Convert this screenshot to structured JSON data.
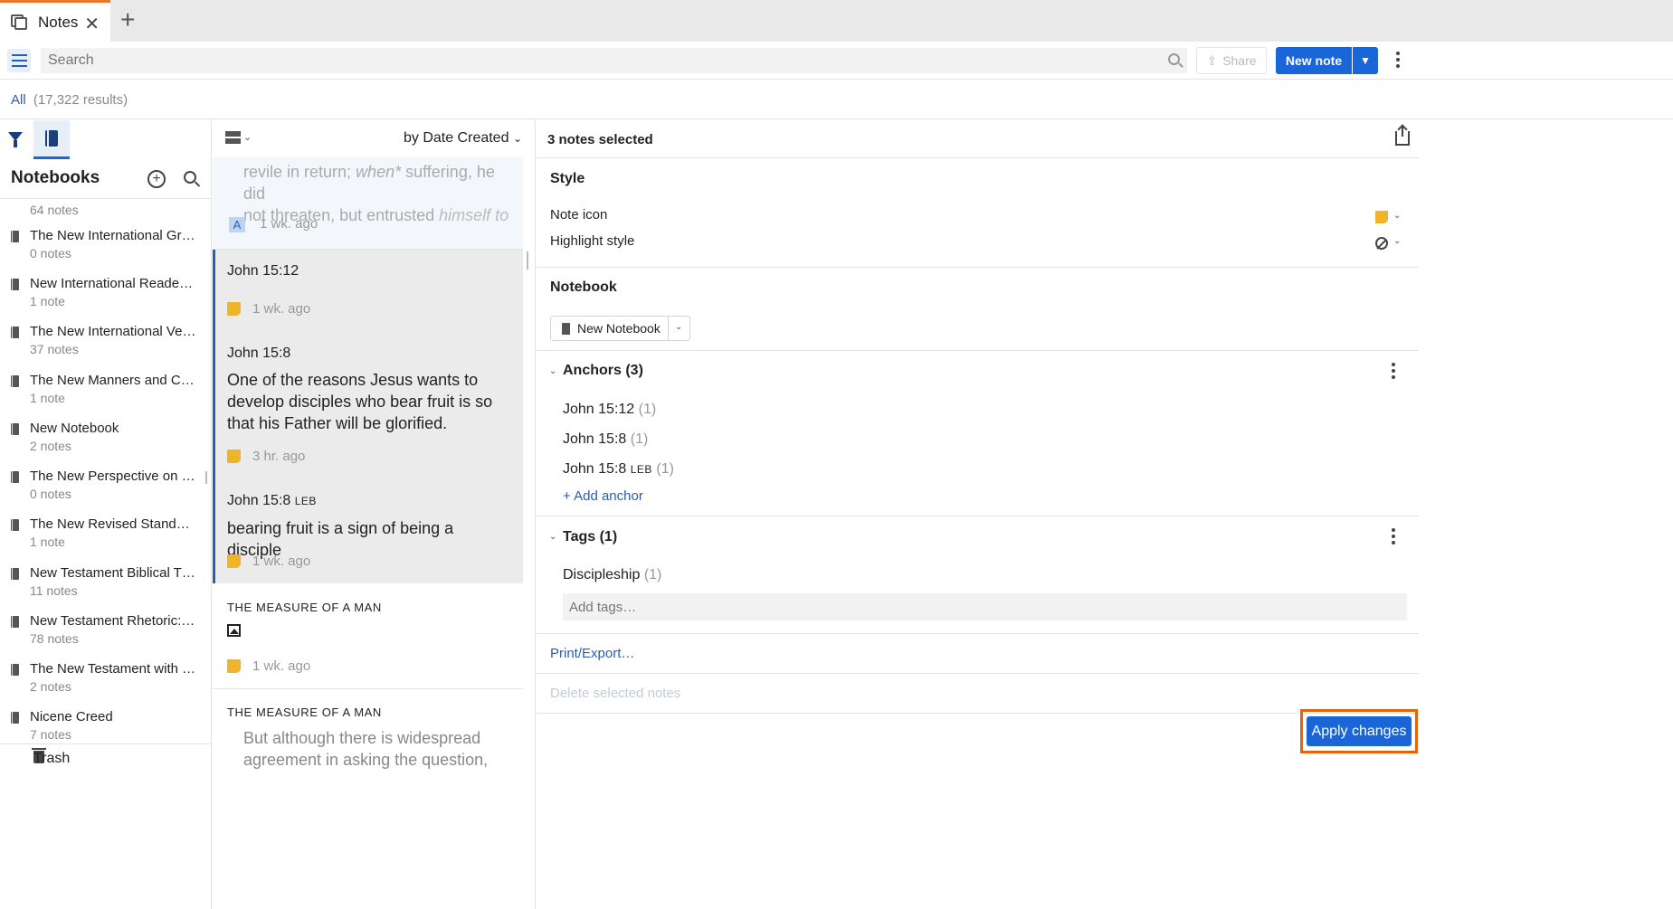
{
  "tab": {
    "label": "Notes"
  },
  "toolbar": {
    "search_placeholder": "Search",
    "share_label": "Share",
    "new_note_label": "New note"
  },
  "results": {
    "filter_label": "All",
    "count": "(17,322 results)"
  },
  "notebooks": {
    "title": "Notebooks",
    "first_count": "64 notes",
    "items": [
      {
        "name": "The New International Gre…",
        "count": "0 notes"
      },
      {
        "name": "New International Reader’…",
        "count": "1 note"
      },
      {
        "name": "The New International Ver…",
        "count": "37 notes"
      },
      {
        "name": "The New Manners and Cus…",
        "count": "1 note"
      },
      {
        "name": "New Notebook",
        "count": "2 notes"
      },
      {
        "name": "The New Perspective on P…",
        "count": "0 notes"
      },
      {
        "name": "The New Revised Standar…",
        "count": "1 note"
      },
      {
        "name": "New Testament Biblical T…",
        "count": "11 notes"
      },
      {
        "name": "New Testament Rhetoric: …",
        "count": "78 notes"
      },
      {
        "name": "The New Testament with I…",
        "count": "2 notes"
      },
      {
        "name": "Nicene Creed",
        "count": "7 notes"
      }
    ],
    "trash_label": "Trash"
  },
  "notes": {
    "sort_label": "by Date Created",
    "first": {
      "line1_a": "revile in return; ",
      "line1_em": "when*",
      "line1_b": " suffering, he did",
      "line2_a": "not threaten, but entrusted ",
      "line2_em": "himself to",
      "badge": "A",
      "time": "1 wk. ago"
    },
    "cards": [
      {
        "ref": "John 15:12",
        "body": "",
        "time": "1 wk. ago"
      },
      {
        "ref": "John 15:8",
        "body": "One of the reasons Jesus wants to develop disciples who bear fruit is so that his Father will be glorified.",
        "time": "3 hr. ago"
      },
      {
        "ref": "John 15:8",
        "ref_version": "LEB",
        "body": "bearing fruit is a sign of being a disciple",
        "time": "1 wk. ago"
      }
    ],
    "measure1": {
      "title": "THE MEASURE OF A MAN",
      "time": "1 wk. ago"
    },
    "measure2": {
      "title": "THE MEASURE OF A MAN",
      "body": "But although there is widespread agreement in asking the question,"
    }
  },
  "details": {
    "selected_count": "3 notes selected",
    "style_title": "Style",
    "note_icon_label": "Note icon",
    "highlight_label": "Highlight style",
    "notebook_title": "Notebook",
    "notebook_value": "New Notebook",
    "anchors_title": "Anchors (3)",
    "anchors": [
      {
        "ref": "John 15:12",
        "version": "",
        "n": "(1)"
      },
      {
        "ref": "John 15:8",
        "version": "",
        "n": "(1)"
      },
      {
        "ref": "John 15:8",
        "version": "LEB",
        "n": "(1)"
      }
    ],
    "add_anchor": "+ Add anchor",
    "tags_title": "Tags (1)",
    "tags": [
      {
        "name": "Discipleship",
        "n": "(1)"
      }
    ],
    "tags_placeholder": "Add tags…",
    "print_export": "Print/Export…",
    "delete_label": "Delete selected notes",
    "apply_label": "Apply changes"
  },
  "colors": {
    "accent": "#1a66d9",
    "tab_accent": "#e8762b",
    "highlight_box": "#e8620a",
    "sticky": "#f0b429"
  }
}
